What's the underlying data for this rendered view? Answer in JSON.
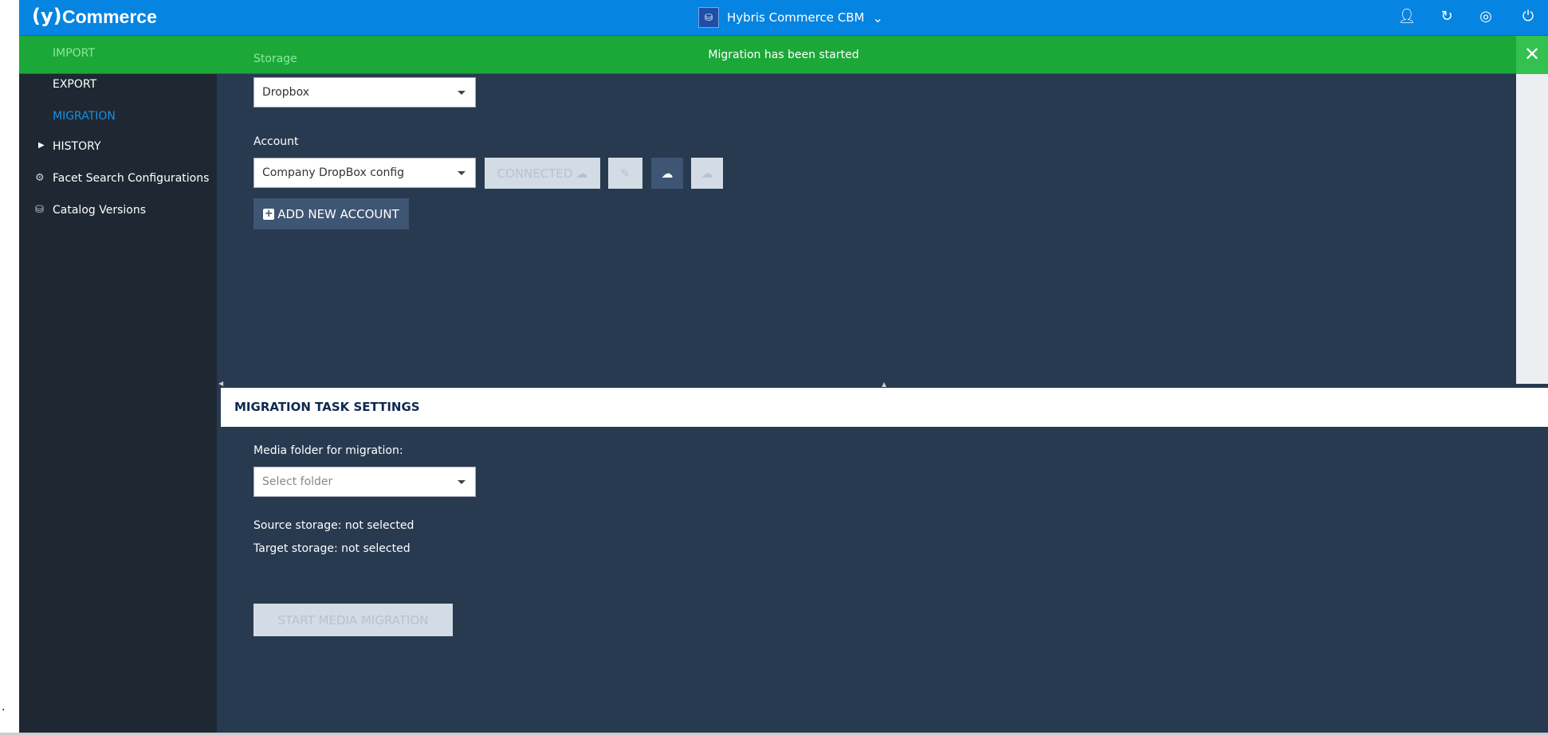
{
  "header": {
    "logo": "(y)",
    "brand": "Commerce",
    "tenant": "Hybris Commerce CBM",
    "tenant_icon": "database-icon",
    "icons": [
      "user-icon",
      "sync-icon",
      "globe-icon",
      "power-icon"
    ]
  },
  "toast": {
    "message": "Migration has been started",
    "color": "#1ca838"
  },
  "sidebar": {
    "items": [
      {
        "label": "IMPORT"
      },
      {
        "label": "EXPORT"
      },
      {
        "label": "MIGRATION",
        "active": true
      },
      {
        "label": "HISTORY"
      },
      {
        "label": "Facet Search Configurations"
      },
      {
        "label": "Catalog Versions"
      }
    ]
  },
  "storage": {
    "label": "Storage",
    "value": "Dropbox"
  },
  "account": {
    "label": "Account",
    "value": "Company DropBox config",
    "connected_label": "CONNECTED",
    "add_label": "ADD NEW ACCOUNT"
  },
  "task": {
    "title": "MIGRATION TASK SETTINGS",
    "folder_label": "Media folder for migration:",
    "folder_placeholder": "Select folder",
    "source": "Source storage: not selected",
    "target": "Target storage: not selected",
    "start_label": "START MEDIA MIGRATION"
  },
  "colors": {
    "header": "#0684e1",
    "sidebar": "#1f2832",
    "main": "#283a50",
    "active": "#1a8fe3"
  }
}
